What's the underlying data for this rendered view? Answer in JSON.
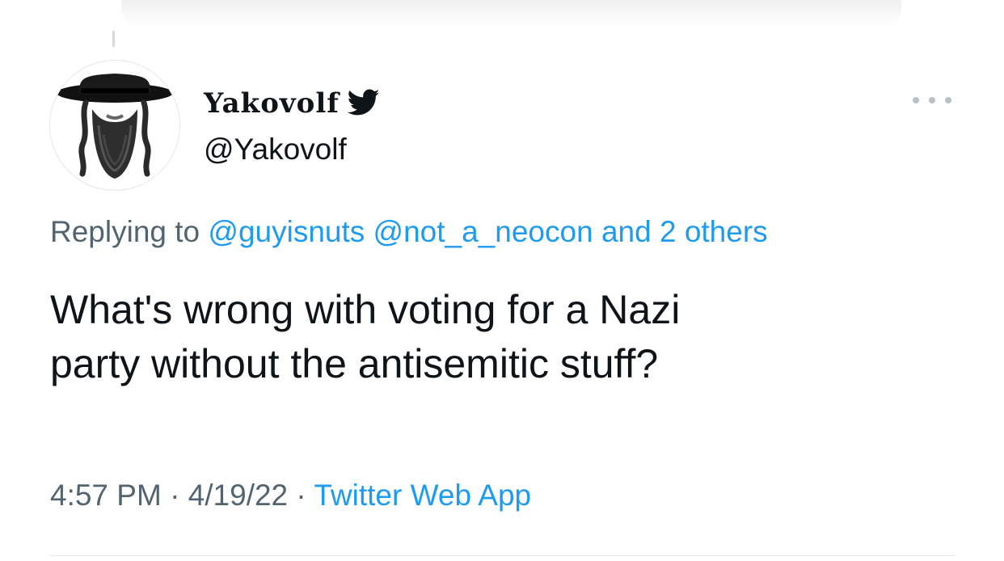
{
  "author": {
    "display_name": "Yakovolf",
    "handle": "@Yakovolf",
    "avatar_icon": "hat-beard-avatar-icon",
    "verified_icon": "twitter-bird-icon"
  },
  "reply": {
    "prefix": "Replying to",
    "mentions": [
      "@guyisnuts",
      "@not_a_neocon"
    ],
    "others": "and 2 others"
  },
  "tweet": {
    "text_line1": "What's wrong with voting for a Nazi",
    "text_line2": "party without the antisemitic stuff?"
  },
  "meta": {
    "time": "4:57 PM",
    "sep": "·",
    "date": "4/19/22",
    "source": "Twitter Web App"
  },
  "colors": {
    "link": "#1d9bf0",
    "text": "#0f1419",
    "muted": "#536471"
  }
}
